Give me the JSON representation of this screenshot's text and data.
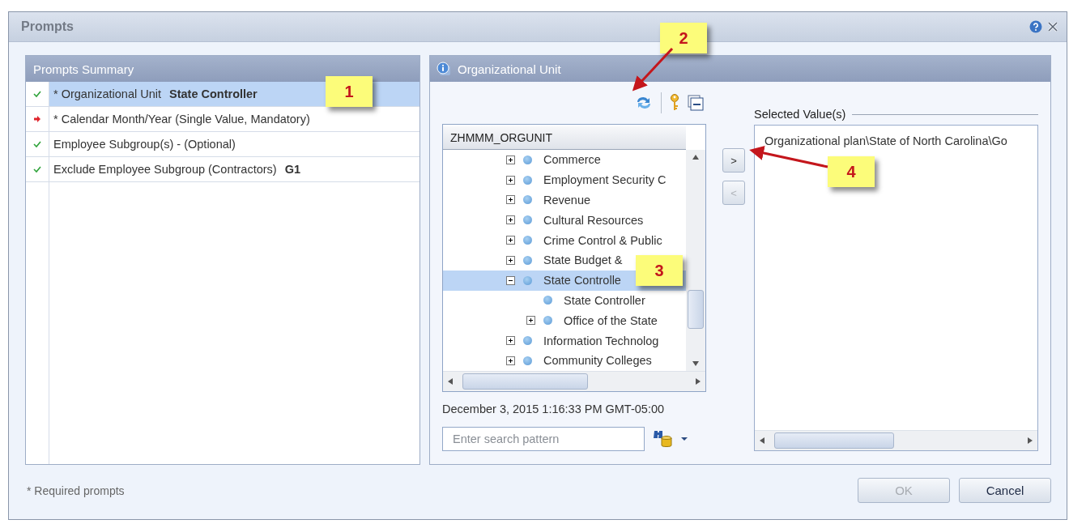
{
  "window": {
    "title": "Prompts"
  },
  "summary": {
    "title": "Prompts Summary",
    "items": [
      {
        "kind": "done",
        "label": "* Organizational Unit",
        "value": "State Controller",
        "selected": true
      },
      {
        "kind": "missing",
        "label": "* Calendar Month/Year (Single Value, Mandatory)",
        "selected": false
      },
      {
        "kind": "done",
        "label": "Employee Subgroup(s) - (Optional)",
        "selected": false
      },
      {
        "kind": "done",
        "label": "Exclude Employee Subgroup (Contractors)",
        "value": "G1",
        "selected": false
      }
    ]
  },
  "prompt": {
    "title": "Organizational Unit",
    "tree": {
      "header": "ZHMMM_ORGUNIT",
      "items": [
        {
          "kind": "branch",
          "label": "Commerce",
          "expanded": false,
          "selected": false
        },
        {
          "kind": "branch",
          "label": "Employment Security C",
          "expanded": false,
          "selected": false
        },
        {
          "kind": "branch",
          "label": "Revenue",
          "expanded": false,
          "selected": false
        },
        {
          "kind": "branch",
          "label": "Cultural Resources",
          "expanded": false,
          "selected": false
        },
        {
          "kind": "branch",
          "label": "Crime Control & Public",
          "expanded": false,
          "selected": false
        },
        {
          "kind": "branch",
          "label": "State Budget &",
          "expanded": false,
          "selected": false
        },
        {
          "kind": "branch",
          "label": "State Controlle",
          "expanded": true,
          "selected": true,
          "children": [
            {
              "kind": "leaf",
              "label": "State Controller",
              "selected": false
            },
            {
              "kind": "branch",
              "label": "Office of the State",
              "expanded": false,
              "selected": false
            }
          ]
        },
        {
          "kind": "branch",
          "label": "Information Technolog",
          "expanded": false,
          "selected": false
        },
        {
          "kind": "branch",
          "label": "Community Colleges",
          "expanded": false,
          "selected": false
        }
      ]
    },
    "timestamp": "December 3, 2015 1:16:33 PM GMT-05:00",
    "search": {
      "placeholder": "Enter search pattern"
    },
    "add_button": {
      "label": ">",
      "disabled": false
    },
    "remove_button": {
      "label": "<",
      "disabled": true
    },
    "selected_values": {
      "title": "Selected Value(s)",
      "items": [
        "Organizational plan\\State of North Carolina\\Go"
      ]
    }
  },
  "footer": {
    "note": "* Required prompts",
    "buttons": [
      {
        "label": "OK",
        "disabled": true
      },
      {
        "label": "Cancel",
        "disabled": false
      }
    ]
  },
  "callouts": [
    {
      "label": "1"
    },
    {
      "label": "2"
    },
    {
      "label": "3"
    },
    {
      "label": "4"
    }
  ]
}
